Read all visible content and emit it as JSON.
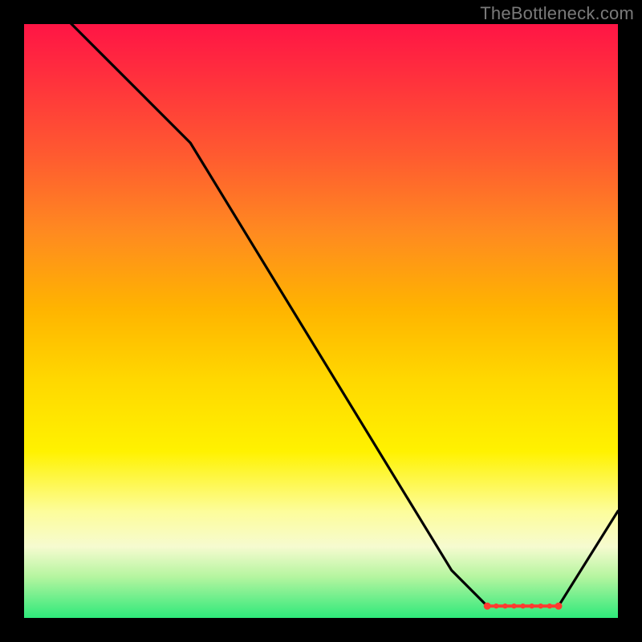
{
  "watermark": "TheBottleneck.com",
  "chart_data": {
    "type": "line",
    "title": "",
    "xlabel": "",
    "ylabel": "",
    "xlim": [
      0,
      100
    ],
    "ylim": [
      0,
      100
    ],
    "grid": false,
    "legend": false,
    "background": {
      "type": "vertical-gradient",
      "stops": [
        {
          "pos": 0,
          "color": "#ff1545"
        },
        {
          "pos": 50,
          "color": "#ffd800"
        },
        {
          "pos": 85,
          "color": "#f6fbd0"
        },
        {
          "pos": 100,
          "color": "#2ee97a"
        }
      ]
    },
    "series": [
      {
        "name": "bottleneck-curve",
        "color": "#000000",
        "x": [
          0,
          8,
          20,
          28,
          72,
          78,
          86,
          90,
          100
        ],
        "y": [
          108,
          100,
          88,
          80,
          8,
          2,
          2,
          2,
          18
        ]
      }
    ],
    "markers": {
      "name": "optimal-range",
      "color": "#ff3b30",
      "y": 2,
      "x_points": [
        78,
        79.5,
        81,
        82.5,
        84,
        85.5,
        87,
        88.5,
        90
      ]
    }
  }
}
